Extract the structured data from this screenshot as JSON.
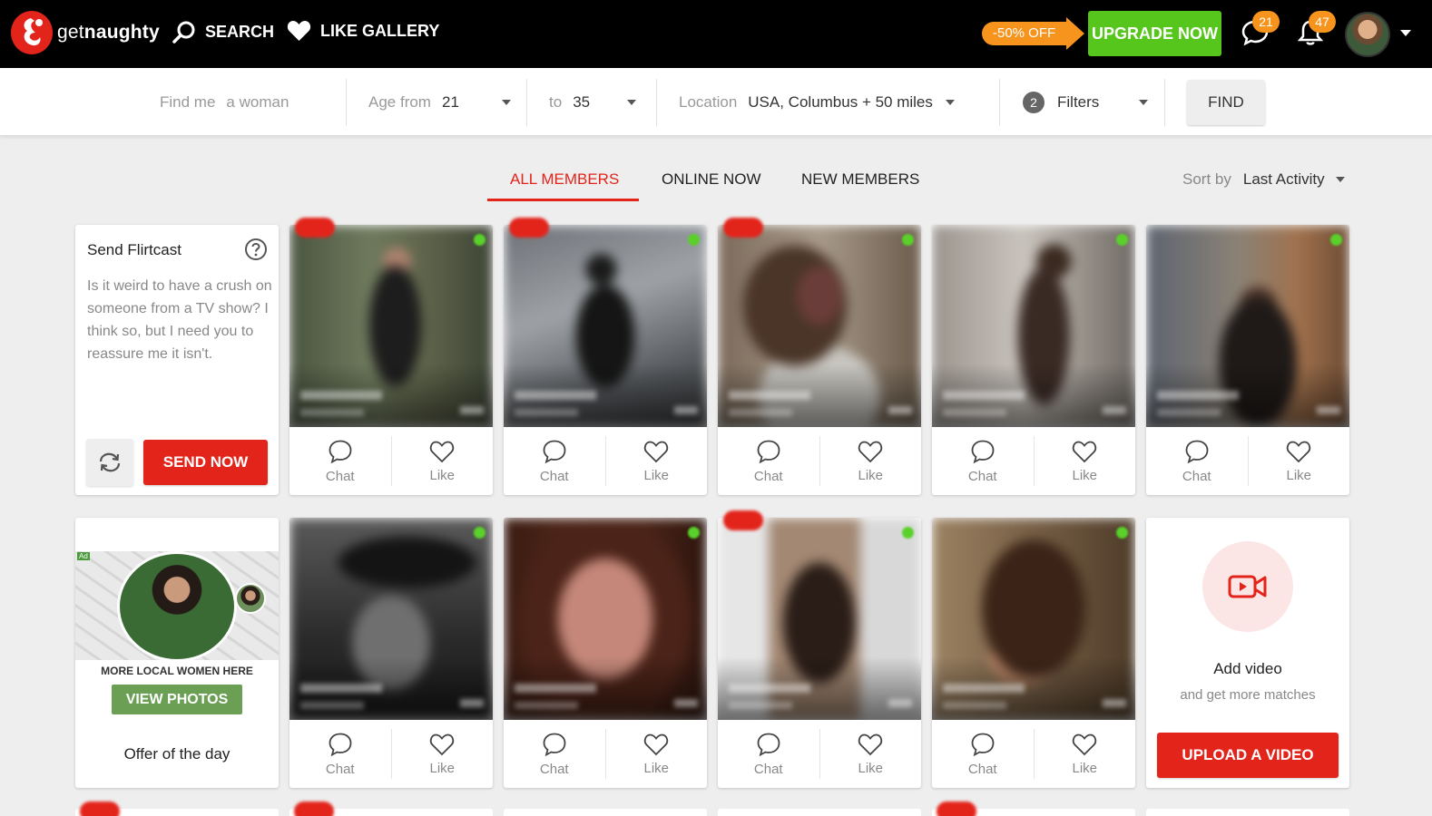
{
  "brand": {
    "name_light": "get",
    "name_bold": "naughty"
  },
  "nav": {
    "search": "SEARCH",
    "like_gallery": "LIKE GALLERY"
  },
  "promo": {
    "discount": "-50% OFF",
    "upgrade": "UPGRADE NOW"
  },
  "notifications": {
    "messages": "21",
    "alerts": "47"
  },
  "filters": {
    "find_me_label": "Find me",
    "find_me_value": "a woman",
    "age_from_label": "Age from",
    "age_from_value": "21",
    "age_to_label": "to",
    "age_to_value": "35",
    "location_label": "Location",
    "location_value": "USA, Columbus + 50 miles",
    "filters_count": "2",
    "filters_label": "Filters",
    "find_button": "FIND"
  },
  "tabs": [
    "ALL MEMBERS",
    "ONLINE NOW",
    "NEW MEMBERS"
  ],
  "active_tab": "ALL MEMBERS",
  "sort": {
    "label": "Sort by",
    "value": "Last Activity"
  },
  "flirtcast": {
    "title": "Send Flirtcast",
    "message": "Is it weird to have a crush on someone from a TV show? I think so, but I need you to reassure me it isn't.",
    "send_button": "SEND NOW"
  },
  "member_actions": {
    "chat": "Chat",
    "like": "Like"
  },
  "ad": {
    "tag": "Ad",
    "heading": "MORE LOCAL WOMEN HERE",
    "button": "VIEW PHOTOS",
    "offer": "Offer of the day"
  },
  "video": {
    "title": "Add video",
    "subtitle": "and get more matches",
    "button": "UPLOAD A VIDEO"
  },
  "colors": {
    "brand_red": "#e3241b",
    "upgrade_green": "#56c51c",
    "promo_orange": "#f7941d",
    "online_green": "#5ad12a"
  }
}
